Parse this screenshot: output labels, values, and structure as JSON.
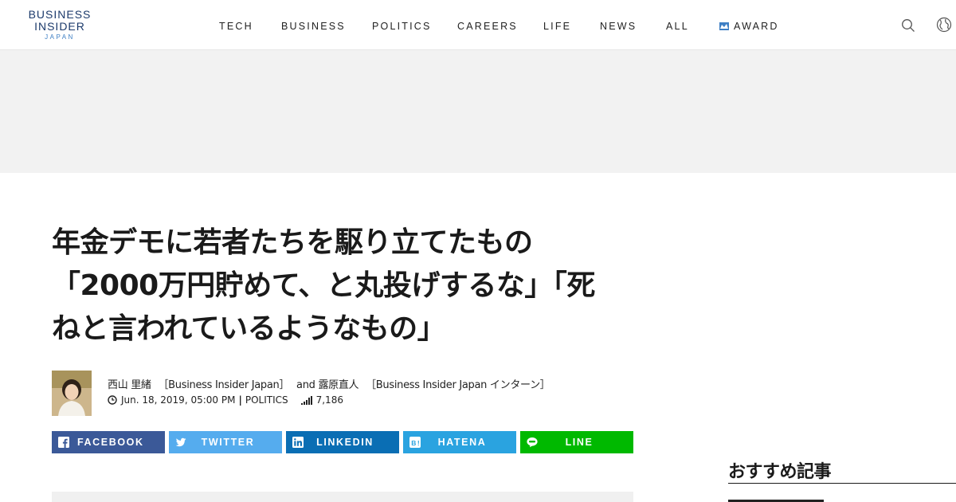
{
  "logo": {
    "line1": "BUSINESS",
    "line2": "INSIDER",
    "line3": "JAPAN"
  },
  "nav": {
    "items": [
      {
        "label": "TECH"
      },
      {
        "label": "BUSINESS"
      },
      {
        "label": "POLITICS"
      },
      {
        "label": "CAREERS"
      },
      {
        "label": "LIFE"
      },
      {
        "label": "NEWS"
      },
      {
        "label": "ALL"
      },
      {
        "label": "AWARD",
        "icon": "award-icon"
      }
    ]
  },
  "header_icons": [
    "search-icon",
    "globe-icon"
  ],
  "article": {
    "title_lines": [
      "年金デモに若者たちを駆り立てたもの",
      "「2000万円貯めて、と丸投げするな」「死",
      "ねと言われているようなもの」"
    ],
    "author1": "西山 里緒",
    "author1_org": "［Business Insider Japan］",
    "conj": "and",
    "author2": "露原直人",
    "author2_org": "［Business Insider Japan インターン］",
    "date": "Jun. 18, 2019, 05:00 PM",
    "category": "POLITICS",
    "views": "7,186"
  },
  "share": {
    "facebook": "FACEBOOK",
    "twitter": "TWITTER",
    "linkedin": "LINKEDIN",
    "hatena": "HATENA",
    "line": "LINE"
  },
  "sidebar": {
    "title": "おすすめ記事"
  },
  "colors": {
    "brand_navy": "#1c3a6b",
    "facebook": "#3b5998",
    "twitter": "#55acee",
    "linkedin": "#0a6eb4",
    "hatena": "#2aa3e0",
    "line": "#00b900"
  }
}
